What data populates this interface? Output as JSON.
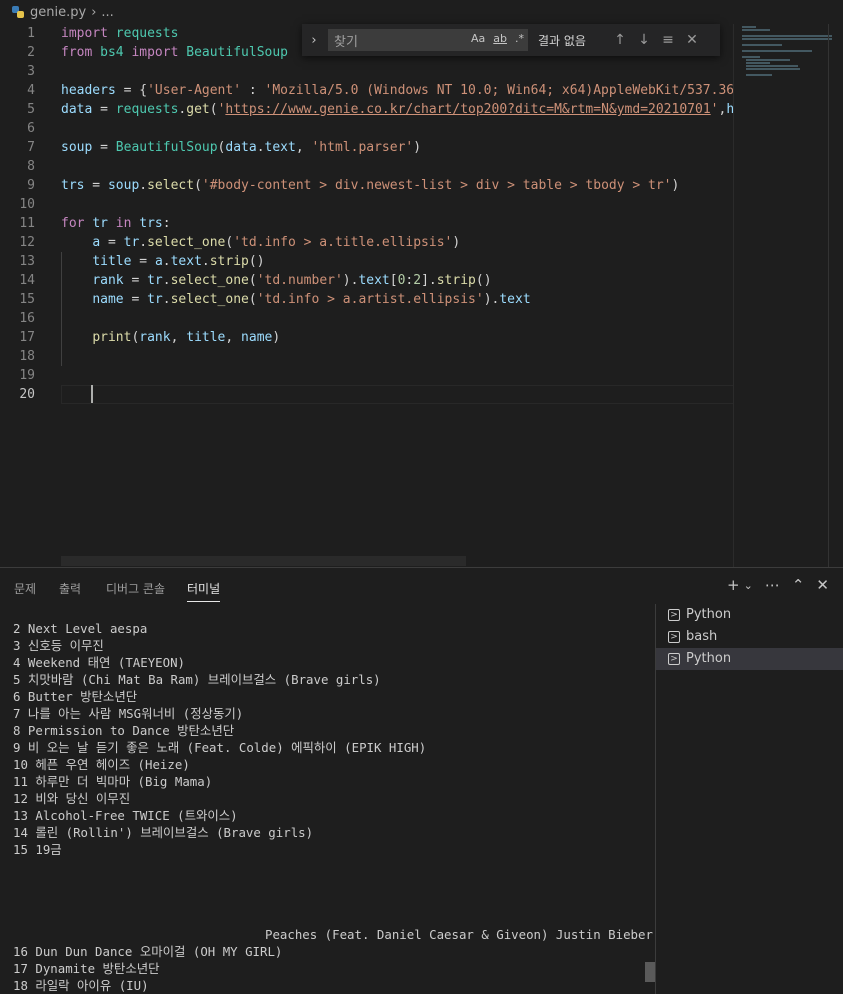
{
  "breadcrumb": {
    "file": "genie.py",
    "rest": "..."
  },
  "editor": {
    "line_numbers": [
      "1",
      "2",
      "3",
      "4",
      "5",
      "6",
      "7",
      "8",
      "9",
      "10",
      "11",
      "12",
      "13",
      "14",
      "15",
      "16",
      "17",
      "18",
      "19",
      "20"
    ]
  },
  "find_widget": {
    "placeholder": "찾기",
    "match_case": "Aa",
    "whole_word": "ab",
    "regex": ".*",
    "result": "결과 없음"
  },
  "panel": {
    "tabs": [
      "문제",
      "출력",
      "디버그 콘솔",
      "터미널"
    ]
  },
  "terminal": {
    "lines": [
      "2 Next Level aespa",
      "3 신호등 이무진",
      "4 Weekend 태연 (TAEYEON)",
      "5 치맛바람 (Chi Mat Ba Ram) 브레이브걸스 (Brave girls)",
      "6 Butter 방탄소년단",
      "7 나를 아는 사람 MSG워너비 (정상동기)",
      "8 Permission to Dance 방탄소년단",
      "9 비 오는 날 듣기 좋은 노래 (Feat. Colde) 에픽하이 (EPIK HIGH)",
      "10 헤픈 우연 헤이즈 (Heize)",
      "11 하루만 더 빅마마 (Big Mama)",
      "12 비와 당신 이무진",
      "13 Alcohol-Free TWICE (트와이스)",
      "14 롤린 (Rollin') 브레이브걸스 (Brave girls)",
      "15 19금"
    ],
    "peaches_line": "Peaches (Feat. Daniel Caesar & Giveon) Justin Bieber",
    "lines_after": [
      "16 Dun Dun Dance 오마이걸 (OH MY GIRL)",
      "17 Dynamite 방탄소년단",
      "18 라일락 아이유 (IU)"
    ]
  },
  "terminal_list": [
    "Python",
    "bash",
    "Python"
  ]
}
